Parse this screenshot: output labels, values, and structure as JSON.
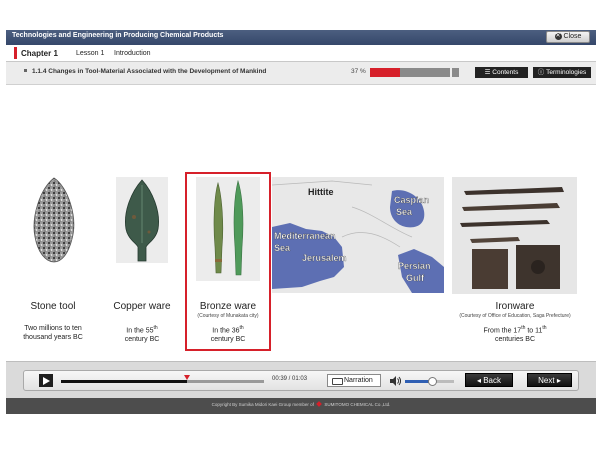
{
  "window": {
    "title": "Technologies and Engineering in Producing Chemical Products",
    "close_label": "Close"
  },
  "chapter": {
    "chapter": "Chapter 1",
    "lesson": "Lesson 1",
    "lesson_title": "Introduction"
  },
  "section": {
    "title": "1.1.4 Changes in Tool-Material Associated with the Development of Mankind",
    "progress_label": "37 %",
    "progress": 0.37,
    "contents_label": "Contents",
    "terminologies_label": "Terminologies"
  },
  "items": [
    {
      "name": "Stone tool",
      "credit": "",
      "era_line1": "Two millions to ten",
      "era_line2": "thousand years BC"
    },
    {
      "name": "Copper ware",
      "credit": "",
      "era_line1": "In the 55",
      "era_sup1": "th",
      "era_line2": "century BC"
    },
    {
      "name": "Bronze ware",
      "credit": "(Courtesy of Munakata city)",
      "era_line1": "In the 36",
      "era_sup1": "th",
      "era_line2": "century BC"
    },
    {
      "name": "Ironware",
      "credit": "(Courtesy of Office of Education, Saga Prefecture)",
      "era_line1": "From the 17",
      "era_sup1": "th",
      "era_mid": " to 11",
      "era_sup2": "th",
      "era_line2": "centuries BC"
    }
  ],
  "map": {
    "labels": {
      "hittite": "Hittite",
      "caspian1": "Caspian",
      "caspian2": "Sea",
      "med1": "Mediterranean",
      "med2": "Sea",
      "jerusalem": "Jerusalem",
      "persian1": "Persian",
      "persian2": "Gulf"
    }
  },
  "controls": {
    "time": "00:39 / 01:03",
    "seek_progress": 0.62,
    "narration_label": "Narration",
    "volume": 0.55,
    "back_label": "Back",
    "next_label": "Next"
  },
  "footer": {
    "text_before": "Copyright By Sumika Midori Kaei Group member of",
    "text_after": "SUMITOMO CHEMICAL Co.,Ltd."
  },
  "colors": {
    "accent": "#d6202a",
    "titlebar": "#3d4f72",
    "map_water": "#5d6fb3"
  }
}
